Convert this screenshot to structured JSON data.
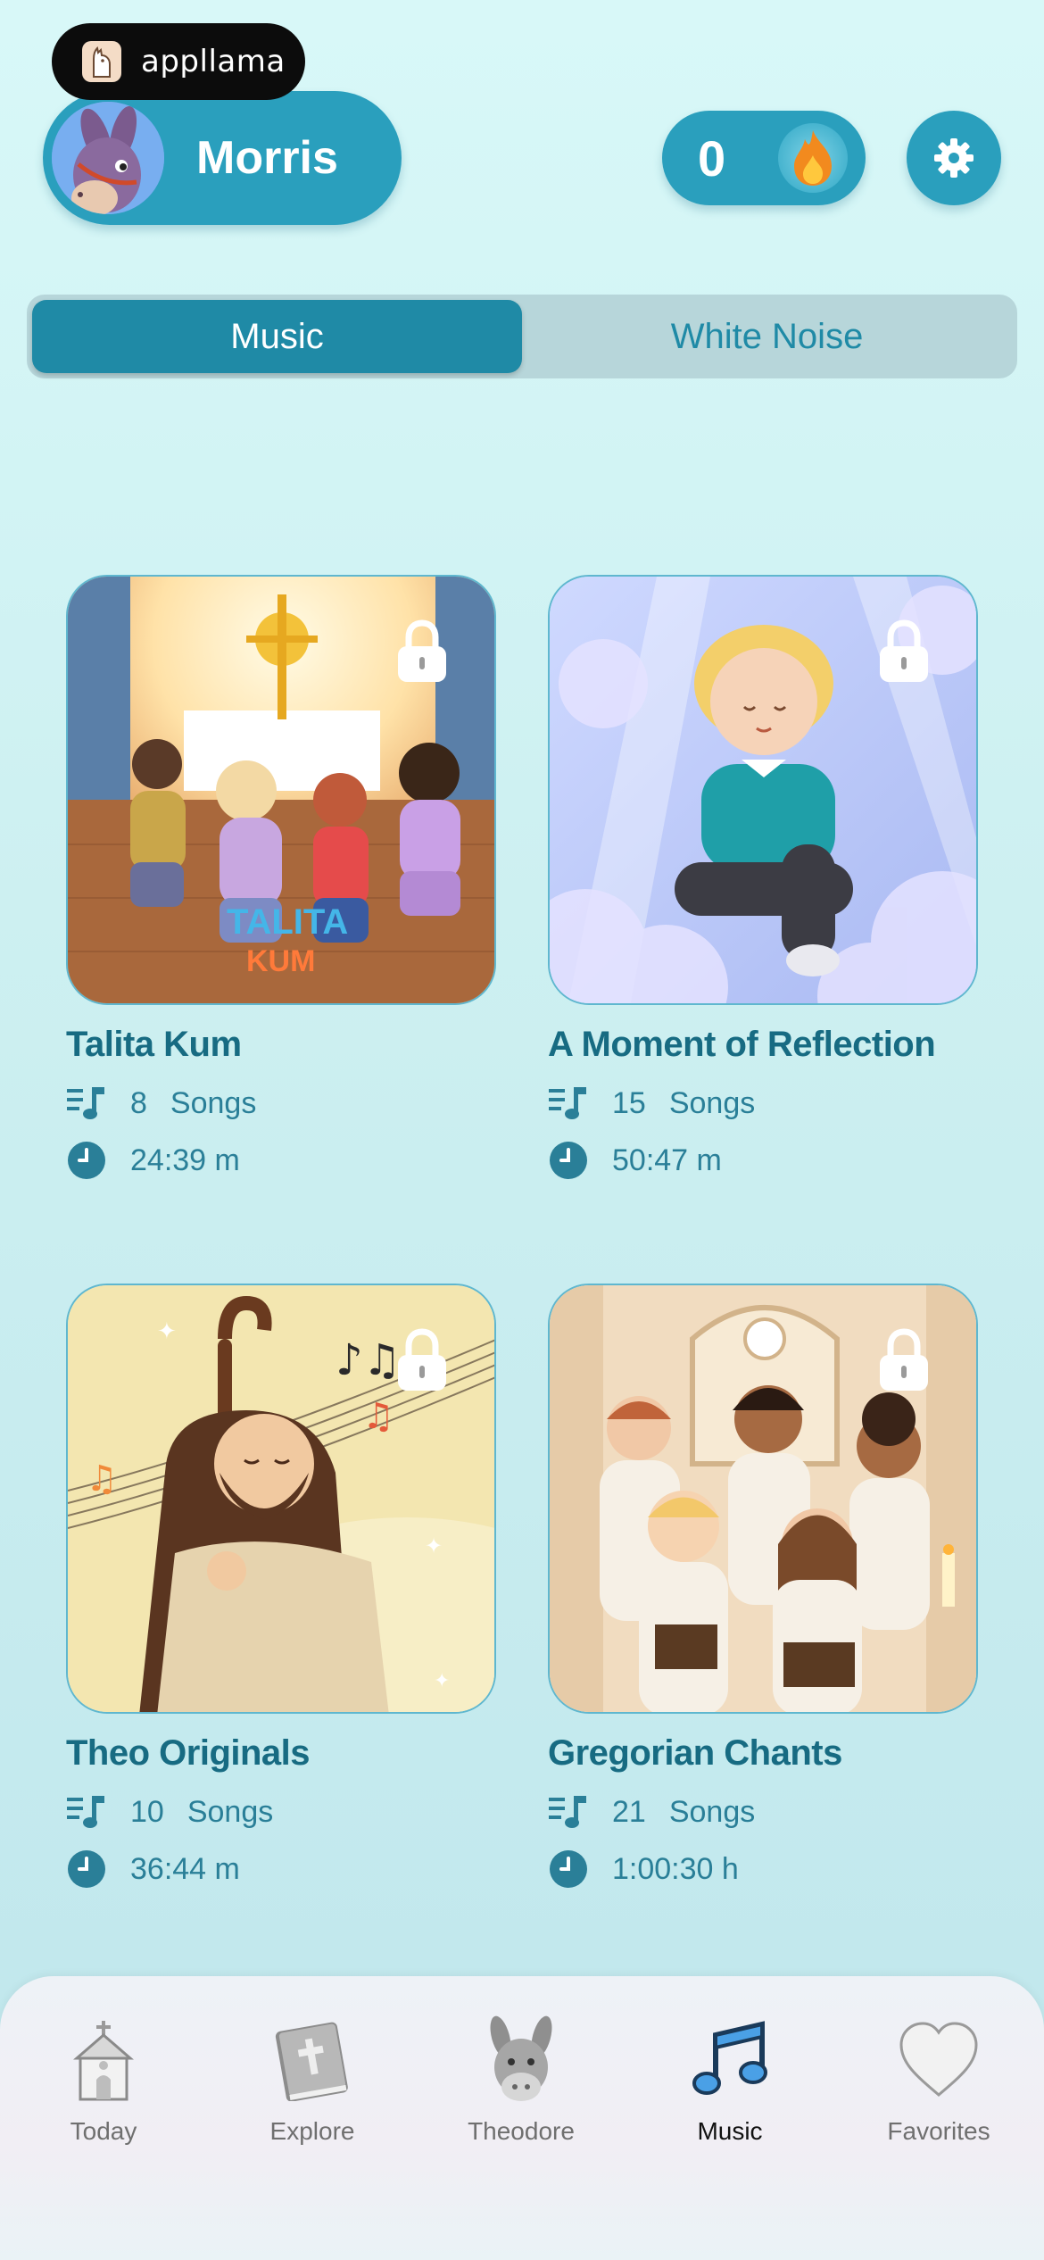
{
  "brand": {
    "name": "appllama"
  },
  "profile": {
    "name": "Morris",
    "avatar_icon": "donkey-avatar"
  },
  "streak": {
    "count": "0",
    "icon": "flame-icon"
  },
  "tabs": [
    {
      "label": "Music",
      "active": true
    },
    {
      "label": "White Noise",
      "active": false
    }
  ],
  "albums": [
    {
      "title": "Talita Kum",
      "songs_count": "8",
      "songs_label": "Songs",
      "duration": "24:39 m",
      "locked": true
    },
    {
      "title": "A Moment of Reflection",
      "songs_count": "15",
      "songs_label": "Songs",
      "duration": "50:47 m",
      "locked": true
    },
    {
      "title": "Theo Originals",
      "songs_count": "10",
      "songs_label": "Songs",
      "duration": "36:44 m",
      "locked": true
    },
    {
      "title": "Gregorian Chants",
      "songs_count": "21",
      "songs_label": "Songs",
      "duration": "1:00:30 h",
      "locked": true
    }
  ],
  "album_art_text": {
    "talita_line1": "TALITA",
    "talita_line2": "KUM"
  },
  "nav": [
    {
      "label": "Today",
      "icon": "chapel-icon"
    },
    {
      "label": "Explore",
      "icon": "bible-icon"
    },
    {
      "label": "Theodore",
      "icon": "donkey-icon"
    },
    {
      "label": "Music",
      "icon": "music-note-icon",
      "active": true
    },
    {
      "label": "Favorites",
      "icon": "heart-icon"
    }
  ],
  "colors": {
    "primary": "#2a9fbd",
    "active_tab": "#1f8aa6",
    "title_text": "#176b82",
    "background": "#d8f8f8"
  }
}
